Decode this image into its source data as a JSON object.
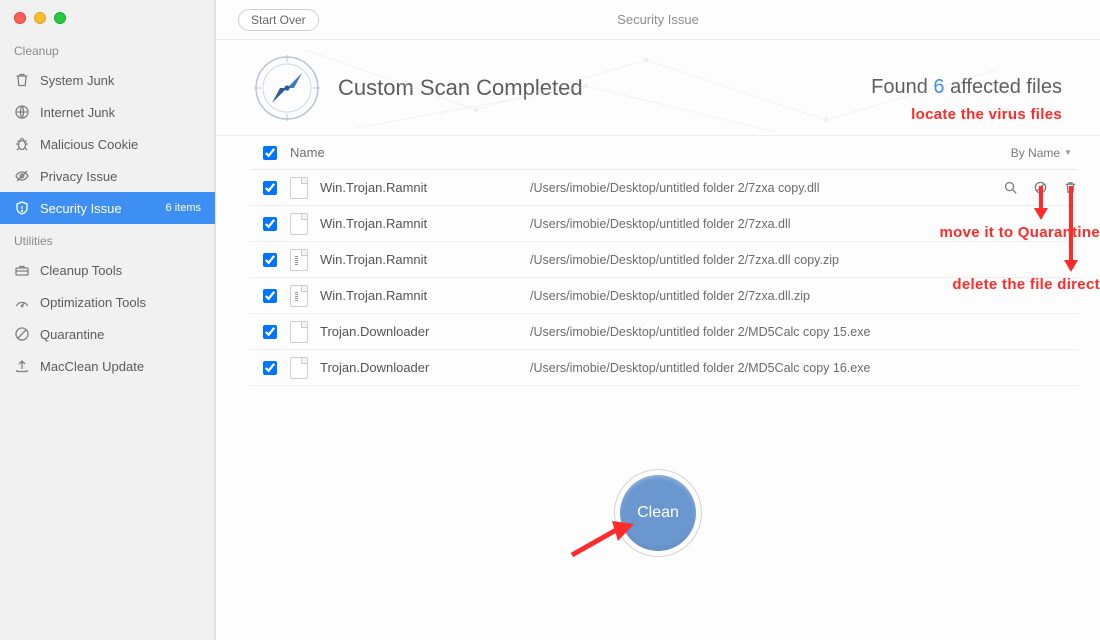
{
  "sidebar": {
    "sections": [
      {
        "label": "Cleanup",
        "items": [
          {
            "icon": "trash-icon",
            "label": "System Junk"
          },
          {
            "icon": "globe-stop-icon",
            "label": "Internet Junk"
          },
          {
            "icon": "bug-icon",
            "label": "Malicious Cookie"
          },
          {
            "icon": "eye-slash-icon",
            "label": "Privacy Issue"
          },
          {
            "icon": "shield-icon",
            "label": "Security Issue",
            "badge": "6 items",
            "active": true
          }
        ]
      },
      {
        "label": "Utilities",
        "items": [
          {
            "icon": "toolbox-icon",
            "label": "Cleanup Tools"
          },
          {
            "icon": "gauge-icon",
            "label": "Optimization Tools"
          },
          {
            "icon": "quarantine-icon",
            "label": "Quarantine"
          },
          {
            "icon": "upload-icon",
            "label": "MacClean Update"
          }
        ]
      }
    ]
  },
  "topbar": {
    "start_over": "Start Over",
    "title": "Security Issue"
  },
  "hero": {
    "title": "Custom Scan Completed",
    "found_prefix": "Found ",
    "found_count": "6",
    "found_suffix": " affected files"
  },
  "table": {
    "header_name": "Name",
    "sort_label": "By Name",
    "rows": [
      {
        "type": "file",
        "name": "Win.Trojan.Ramnit",
        "path": "/Users/imobie/Desktop/untitled folder 2/7zxa copy.dll",
        "show_actions": true
      },
      {
        "type": "file",
        "name": "Win.Trojan.Ramnit",
        "path": "/Users/imobie/Desktop/untitled folder 2/7zxa.dll"
      },
      {
        "type": "zip",
        "name": "Win.Trojan.Ramnit",
        "path": "/Users/imobie/Desktop/untitled folder 2/7zxa.dll copy.zip"
      },
      {
        "type": "zip",
        "name": "Win.Trojan.Ramnit",
        "path": "/Users/imobie/Desktop/untitled folder 2/7zxa.dll.zip"
      },
      {
        "type": "file",
        "name": "Trojan.Downloader",
        "path": "/Users/imobie/Desktop/untitled folder 2/MD5Calc copy 15.exe"
      },
      {
        "type": "file",
        "name": "Trojan.Downloader",
        "path": "/Users/imobie/Desktop/untitled folder 2/MD5Calc copy 16.exe"
      }
    ]
  },
  "clean_label": "Clean",
  "annotations": {
    "locate": "locate the virus files",
    "quarantine": "move it to Quarantine",
    "delete": "delete the file directly"
  }
}
